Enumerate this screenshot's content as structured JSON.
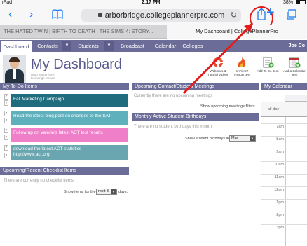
{
  "status": {
    "carrier": "iPad",
    "time": "2:17 PM",
    "battery": "38%"
  },
  "browser": {
    "url": "arborbridge.collegeplannerpro.com",
    "tabs": [
      {
        "label": "THE HATED TWIN | BIRTH TO DEATH | THE SIMS 4: STORY...",
        "active": false
      },
      {
        "label": "My Dashboard | CollegePlannerPro",
        "active": true
      }
    ],
    "share_highlight_color": "#e21b1b"
  },
  "nav": {
    "items": [
      "Dashboard",
      "Contacts",
      "Students",
      "Broadcast",
      "Calendar",
      "Colleges"
    ],
    "user": "Joe Co"
  },
  "header": {
    "title": "My Dashboard",
    "avatar_caption_1": "Drop image here",
    "avatar_caption_2": "to change picture"
  },
  "quick_actions": [
    {
      "label": "Webinars & Tutorial Videos",
      "icon": "lifebuoy-icon"
    },
    {
      "label": "SAT/ACT Resources",
      "icon": "flame-icon"
    },
    {
      "label": "Add To Do Item",
      "icon": "add-todo-icon"
    },
    {
      "label": "Add a Calendar Item",
      "icon": "add-calendar-icon"
    }
  ],
  "todo": {
    "title": "My To-Do Items",
    "items": [
      {
        "text": "Fall Marketing Campaign",
        "color": "#1f6c7f"
      },
      {
        "text": "Read the latest blog post on changes to the SAT",
        "color": "#5fb0bd"
      },
      {
        "text": "Follow up on Valerie's latest ACT test results",
        "color": "#ef7fc9"
      },
      {
        "text": "download the latest ACT statistics",
        "text2": "http://www.act.org",
        "color": "#6aa6b0"
      }
    ]
  },
  "checklist": {
    "title": "Upcoming/Recent Checklist Items",
    "empty": "There are currently no checklist items",
    "show_prefix": "Show items for the",
    "show_value": "next 3",
    "show_suffix": "days."
  },
  "meetings": {
    "title": "Upcoming Contact/Student Meetings",
    "empty": "Currently there are no upcoming meetings",
    "filters_link": "Show upcoming meetings filters"
  },
  "birthdays": {
    "title": "Monthly Active Student Birthdays",
    "empty": "There are no student birthdays this month",
    "show_label": "Show student birthdays in:",
    "month": "May"
  },
  "calendar": {
    "title": "My Calendar",
    "allday": "all-day",
    "hours": [
      "7am",
      "8am",
      "9am",
      "10am",
      "11am",
      "12pm",
      "1pm",
      "2pm",
      "3pm"
    ]
  },
  "colors": {
    "nav": "#6b6c97",
    "accent": "#5a5b8c",
    "ios_blue": "#1a7cf5"
  }
}
